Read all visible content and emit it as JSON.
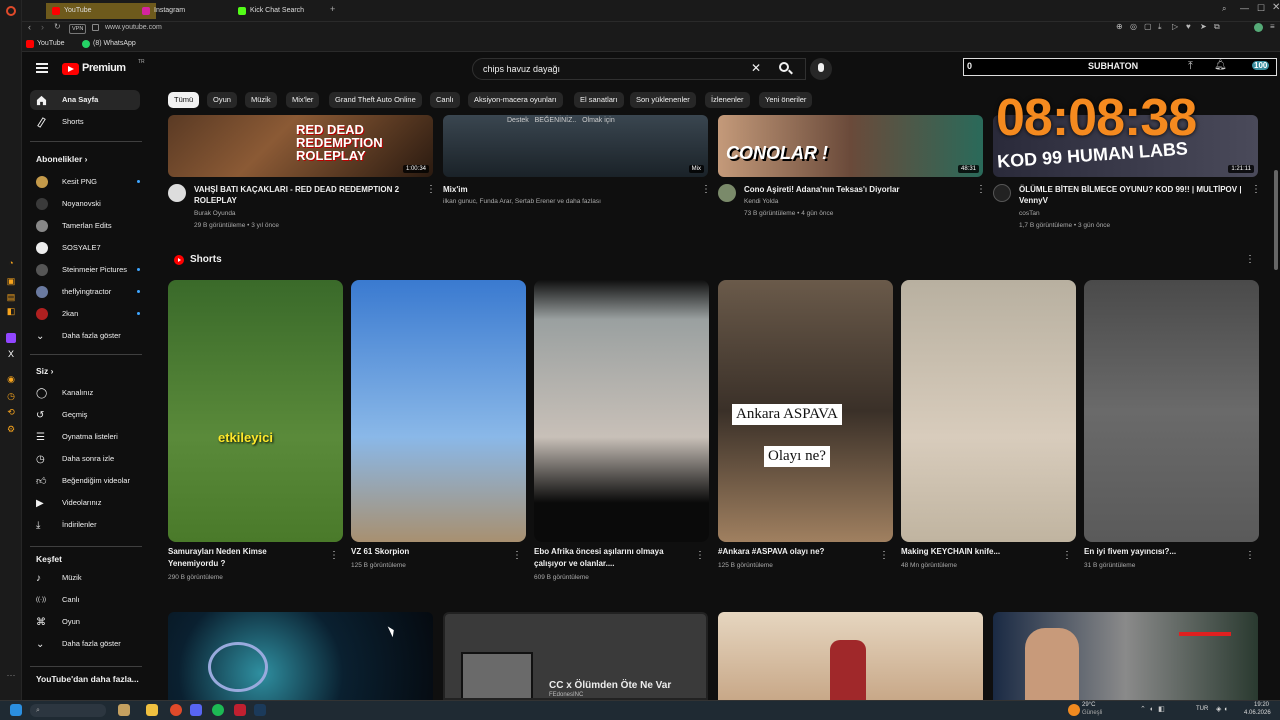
{
  "browser": {
    "tabs": [
      {
        "label": "YouTube",
        "active": true
      },
      {
        "label": "Instagram"
      },
      {
        "label": "Kick Chat Search"
      }
    ],
    "url": "www.youtube.com",
    "vpn": "VPN",
    "bookmarks": [
      {
        "label": "YouTube"
      },
      {
        "label": "(8) WhatsApp"
      }
    ]
  },
  "header": {
    "logo_text": "Premium",
    "logo_sup": "TR",
    "search_value": "chips havuz dayağı",
    "overlay": {
      "left_value": "0",
      "title": "SUBHATON",
      "count": "100"
    },
    "timer": "08:08:38"
  },
  "chips": [
    "Tümü",
    "Oyun",
    "Müzik",
    "Mix'ler",
    "Grand Theft Auto Online",
    "Canlı",
    "Aksiyon-macera oyunları",
    "El sanatları",
    "Son yüklenenler",
    "İzlenenler",
    "Yeni öneriler"
  ],
  "sidebar": {
    "main": [
      {
        "label": "Ana Sayfa",
        "icon": "home-icon"
      },
      {
        "label": "Shorts",
        "icon": "shorts-icon"
      }
    ],
    "subs_heading": "Abonelikler",
    "subs": [
      {
        "label": "Kesit PNG",
        "dot": true
      },
      {
        "label": "Noyanovski",
        "dot": false
      },
      {
        "label": "Tamerlan Edits",
        "dot": false
      },
      {
        "label": "SOSYALE7",
        "dot": false
      },
      {
        "label": "Steinmeier Pictures",
        "dot": true
      },
      {
        "label": "theflyingtractor",
        "dot": true
      },
      {
        "label": "2kan",
        "dot": true
      },
      {
        "label": "Daha fazla göster",
        "dot": false
      }
    ],
    "you_heading": "Siz",
    "you": [
      {
        "label": "Kanalınız",
        "icon": "channel-icon"
      },
      {
        "label": "Geçmiş",
        "icon": "history-icon"
      },
      {
        "label": "Oynatma listeleri",
        "icon": "playlist-icon"
      },
      {
        "label": "Daha sonra izle",
        "icon": "clock-icon"
      },
      {
        "label": "Beğendiğim videolar",
        "icon": "thumbs-up-icon"
      },
      {
        "label": "Videolarınız",
        "icon": "video-icon"
      },
      {
        "label": "İndirilenler",
        "icon": "download-icon"
      }
    ],
    "explore_heading": "Keşfet",
    "explore": [
      {
        "label": "Müzik",
        "icon": "music-icon"
      },
      {
        "label": "Canlı",
        "icon": "live-icon"
      },
      {
        "label": "Oyun",
        "icon": "gaming-icon"
      },
      {
        "label": "Daha fazla göster",
        "icon": "chevron-down-icon"
      }
    ],
    "more_heading": "YouTube'dan daha fazla..."
  },
  "videos_top": [
    {
      "title": "VAHŞİ BATI KAÇAKLARI - RED DEAD REDEMPTION 2 ROLEPLAY",
      "channel": "Burak Oyunda",
      "meta": "29 B görüntüleme • 3 yıl önce",
      "duration": "1:00:34",
      "thumb_text": "RED DEAD REDEMPTION ROLEPLAY"
    },
    {
      "title": "Mix'im",
      "channel": "ilkan gunuc, Funda Arar, Sertab Erener ve daha fazlası",
      "meta": "",
      "duration": "Mix",
      "thumb_text": "Destek   BEĞENİNİZ..   Olmak için"
    },
    {
      "title": "Cono Aşireti! Adana'nın Teksas'ı Diyorlar",
      "channel": "Kendi Yolda",
      "meta": "73 B görüntüleme • 4 gün önce",
      "duration": "48:31",
      "thumb_text": "CONOLAR !"
    },
    {
      "title": "ÖLÜMLE BİTEN BİLMECE OYUNU? KOD 99!! | MULTİPOV | VennyV",
      "channel": "cosTan",
      "meta": "1,7 B görüntüleme • 3 gün önce",
      "duration": "1:21:11",
      "thumb_text": "KOD 99 HUMAN LABS"
    }
  ],
  "shorts_heading": "Shorts",
  "shorts": [
    {
      "title": "Samurayları Neden Kimse Yenemiyordu ?",
      "meta": "290 B görüntüleme",
      "overlay": "etkileyici"
    },
    {
      "title": "VZ 61 Skorpion",
      "meta": "125 B görüntüleme",
      "overlay": ""
    },
    {
      "title": "Ebo Afrika öncesi aşılarını olmaya çalışıyor ve olanlar....",
      "meta": "609 B görüntüleme",
      "overlay": ""
    },
    {
      "title": "#Ankara #ASPAVA olayı ne?",
      "meta": "125 B görüntüleme",
      "overlay": "Ankara ASPAVA|Olayı ne?"
    },
    {
      "title": "Making KEYCHAIN knife...",
      "meta": "48 Mn görüntüleme",
      "overlay": ""
    },
    {
      "title": "En iyi fivem yayıncısı?...",
      "meta": "31 B görüntüleme",
      "overlay": ""
    }
  ],
  "videos_bottom": [
    {
      "thumb_text": ""
    },
    {
      "thumb_text": "CC x Ölümden Öte Ne Var",
      "sub": "FEdonesINC"
    },
    {
      "thumb_text": ""
    },
    {
      "thumb_text": ""
    }
  ],
  "taskbar": {
    "weather": "29°C",
    "weather_sub": "Güneşli",
    "lang": "TUR",
    "time": "19:20",
    "date": "4.06.2026"
  }
}
